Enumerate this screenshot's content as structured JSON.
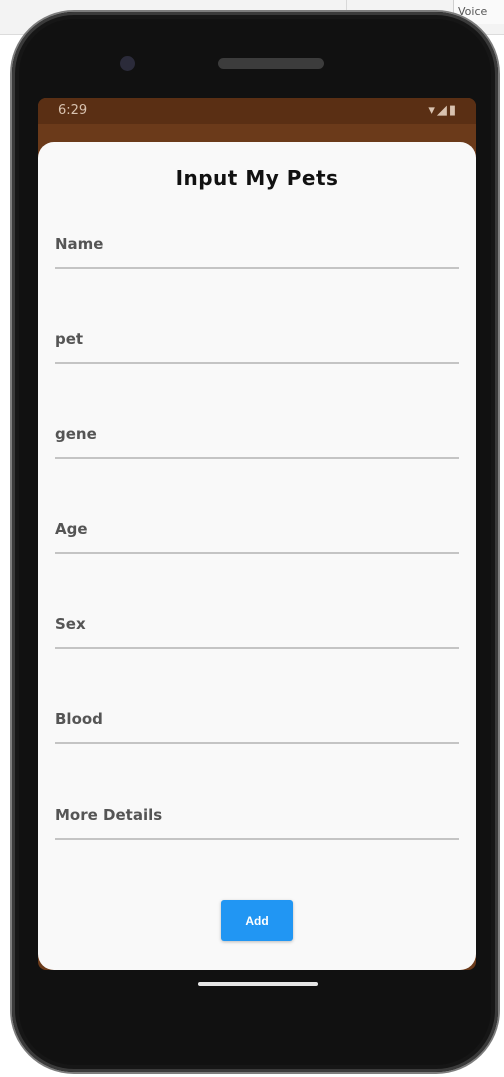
{
  "host": {
    "tab_label": "Voice"
  },
  "status_bar": {
    "time": "6:29",
    "icons": "▾◢▮"
  },
  "dialog": {
    "title": "Input My Pets",
    "fields": [
      {
        "label": "Name"
      },
      {
        "label": "pet"
      },
      {
        "label": "gene"
      },
      {
        "label": "Age"
      },
      {
        "label": "Sex"
      },
      {
        "label": "Blood"
      },
      {
        "label": "More Details"
      }
    ],
    "add_label": "Add"
  },
  "colors": {
    "accent": "#2196f3",
    "app_bar": "#6b3a1a",
    "dialog_bg": "#f9f9f9"
  }
}
